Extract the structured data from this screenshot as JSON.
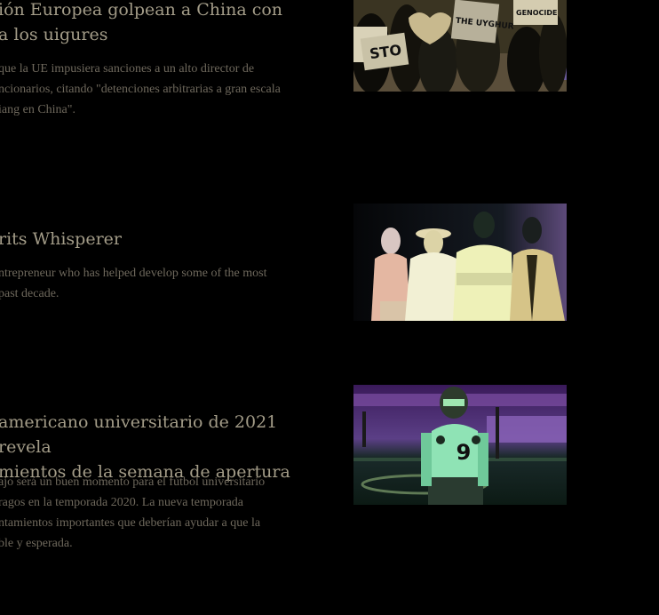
{
  "articles": [
    {
      "headline": "ión Europea golpean a China con\na los uigures",
      "summary": " que la UE impusiera sanciones a un alto director de\nncionarios, citando \"detenciones arbitrarias a gran escala\niang en China\".",
      "image_icon": "protest-photo",
      "image_text": [
        "STO",
        "THE UYGHUR",
        "GENOCIDE"
      ]
    },
    {
      "headline": "rits Whisperer",
      "summary": "ntrepreneur who has helped develop some of the most\n past decade.",
      "image_icon": "group-portrait-photo"
    },
    {
      "headline": " americano universitario de 2021 revela\nmientos de la semana de apertura",
      "summary": "ajo será un buen momento para el fútbol universitario\nragos en la temporada 2020. La nueva temporada\nntamientos importantes que deberían ayudar a que la\nble y esperada.",
      "image_icon": "football-player-photo",
      "image_text": [
        "9"
      ]
    }
  ]
}
